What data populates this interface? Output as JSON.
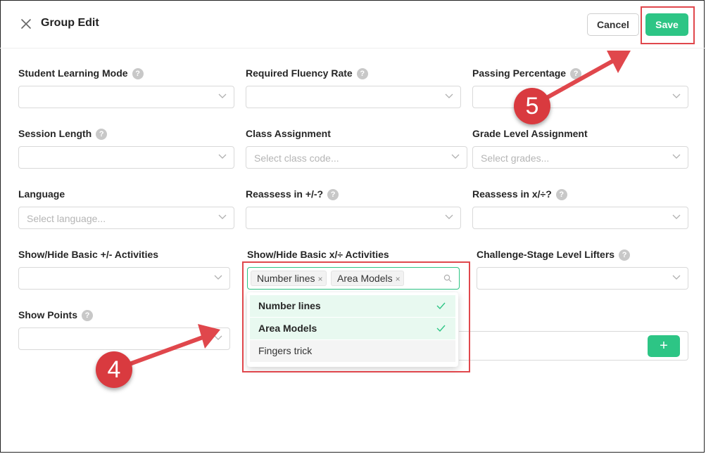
{
  "header": {
    "title": "Group Edit",
    "cancel_label": "Cancel",
    "save_label": "Save",
    "close_icon": "close-icon"
  },
  "fields": {
    "student_learning_mode": {
      "label": "Student Learning Mode",
      "help": "?",
      "value": ""
    },
    "required_fluency_rate": {
      "label": "Required Fluency Rate",
      "help": "?",
      "value": ""
    },
    "passing_percentage": {
      "label": "Passing Percentage",
      "help": "?",
      "value": ""
    },
    "session_length": {
      "label": "Session Length",
      "help": "?",
      "value": ""
    },
    "class_assignment": {
      "label": "Class Assignment",
      "placeholder": "Select class code..."
    },
    "grade_level_assignment": {
      "label": "Grade Level Assignment",
      "placeholder": "Select grades..."
    },
    "language": {
      "label": "Language",
      "placeholder": "Select language..."
    },
    "reassess_add_sub": {
      "label": "Reassess in +/-?",
      "help": "?",
      "value": ""
    },
    "reassess_mul_div": {
      "label": "Reassess in x/÷?",
      "help": "?",
      "value": ""
    },
    "show_hide_basic_add_sub": {
      "label": "Show/Hide Basic +/- Activities",
      "value": ""
    },
    "show_hide_basic_mul_div": {
      "label": "Show/Hide Basic x/÷ Activities",
      "selected_tags": [
        "Number lines",
        "Area Models"
      ],
      "tag_remove": "×",
      "options": [
        {
          "label": "Number lines",
          "selected": true
        },
        {
          "label": "Area Models",
          "selected": true
        },
        {
          "label": "Fingers trick",
          "selected": false
        }
      ]
    },
    "challenge_stage_level_lifters": {
      "label": "Challenge-Stage Level Lifters",
      "help": "?",
      "value": ""
    },
    "show_points": {
      "label": "Show Points",
      "help": "?",
      "value": ""
    }
  },
  "add_button": {
    "label": "+"
  },
  "annotations": {
    "step_4": "4",
    "step_5": "5",
    "highlight_color": "#e0474c"
  },
  "colors": {
    "accent": "#2dc585",
    "selected_option_bg": "#e8f9f0"
  }
}
